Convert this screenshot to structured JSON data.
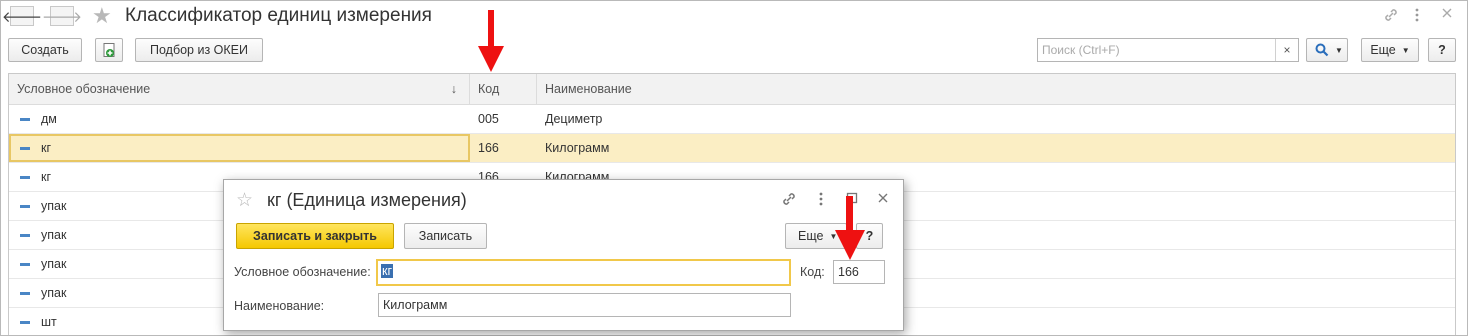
{
  "window": {
    "title": "Классификатор единиц измерения",
    "back_glyph": "🡐",
    "forward_glyph": "🡒",
    "star_glyph": "☆"
  },
  "toolbar": {
    "create_label": "Создать",
    "select_okei_label": "Подбор из ОКЕИ",
    "search_placeholder": "Поиск (Ctrl+F)",
    "search_clear": "×",
    "search_icon": "🔍",
    "more_label": "Еще",
    "help_label": "?"
  },
  "table": {
    "columns": [
      "Условное обозначение",
      "Код",
      "Наименование"
    ],
    "sort_arrow": "↓",
    "rows": [
      {
        "symbol": "дм",
        "code": "005",
        "name": "Дециметр"
      },
      {
        "symbol": "кг",
        "code": "166",
        "name": "Килограмм"
      },
      {
        "symbol": "кг",
        "code": "166",
        "name": "Килограмм"
      },
      {
        "symbol": "упак",
        "code": "",
        "name": ""
      },
      {
        "symbol": "упак",
        "code": "",
        "name": ""
      },
      {
        "symbol": "упак",
        "code": "",
        "name": ""
      },
      {
        "symbol": "упак",
        "code": "",
        "name": ""
      },
      {
        "symbol": "шт",
        "code": "",
        "name": ""
      }
    ],
    "selected_row": 1
  },
  "dialog": {
    "title": "кг (Единица измерения)",
    "save_close_label": "Записать и закрыть",
    "save_label": "Записать",
    "more_label": "Еще",
    "help_label": "?",
    "symbol_label": "Условное обозначение:",
    "symbol_value": "кг",
    "code_label": "Код:",
    "code_value": "166",
    "name_label": "Наименование:",
    "name_value": "Килограмм"
  },
  "colors": {
    "accent_yellow": "#f5c800",
    "selection_row": "#fbeec4",
    "annotation_arrow": "#ee1111"
  }
}
